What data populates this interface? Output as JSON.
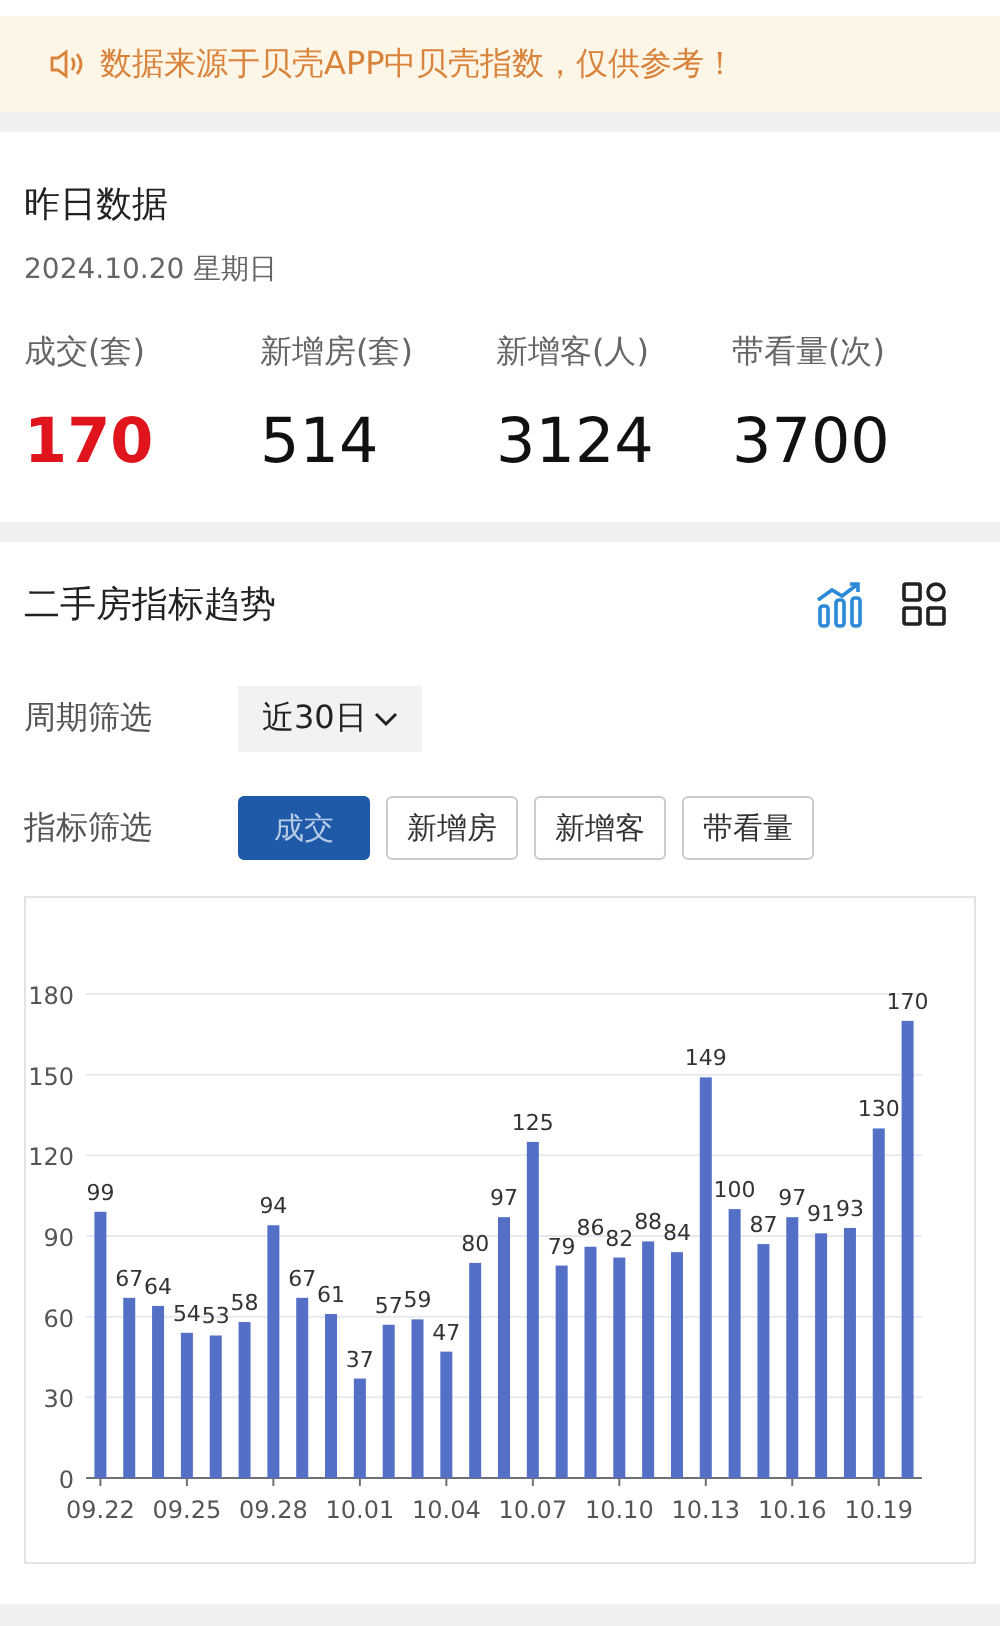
{
  "notice": {
    "text": "数据来源于贝壳APP中贝壳指数，仅供参考！"
  },
  "yesterday": {
    "title": "昨日数据",
    "date": "2024.10.20 星期日",
    "stats": [
      {
        "label": "成交(套)",
        "value": "170",
        "highlight": true
      },
      {
        "label": "新增房(套)",
        "value": "514",
        "highlight": false
      },
      {
        "label": "新增客(人)",
        "value": "3124",
        "highlight": false
      },
      {
        "label": "带看量(次)",
        "value": "3700",
        "highlight": false
      }
    ]
  },
  "trend": {
    "title": "二手房指标趋势",
    "view_modes": [
      {
        "kind": "chart",
        "selected": true
      },
      {
        "kind": "grid",
        "selected": false
      }
    ],
    "period_filter": {
      "label": "周期筛选",
      "value": "近30日"
    },
    "metric_filter": {
      "label": "指标筛选",
      "options": [
        {
          "label": "成交",
          "selected": true
        },
        {
          "label": "新增房",
          "selected": false
        },
        {
          "label": "新增客",
          "selected": false
        },
        {
          "label": "带看量",
          "selected": false
        }
      ]
    },
    "chart_data": {
      "type": "bar",
      "categories": [
        "09.22",
        null,
        null,
        "09.25",
        null,
        null,
        "09.28",
        null,
        null,
        "10.01",
        null,
        null,
        "10.04",
        null,
        null,
        "10.07",
        null,
        null,
        "10.10",
        null,
        null,
        "10.13",
        null,
        null,
        "10.16",
        null,
        null,
        "10.19",
        null
      ],
      "series": [
        {
          "color": "#5470c6",
          "values": [
            99,
            67,
            64,
            54,
            53,
            58,
            94,
            67,
            61,
            37,
            57,
            59,
            47,
            80,
            97,
            125,
            79,
            86,
            82,
            88,
            84,
            149,
            100,
            87,
            97,
            91,
            93,
            130,
            170
          ]
        }
      ],
      "ylim": [
        0,
        180
      ],
      "yticks": [
        0,
        30,
        60,
        90,
        120,
        150,
        180
      ],
      "grid": true,
      "data_labels": true
    }
  }
}
